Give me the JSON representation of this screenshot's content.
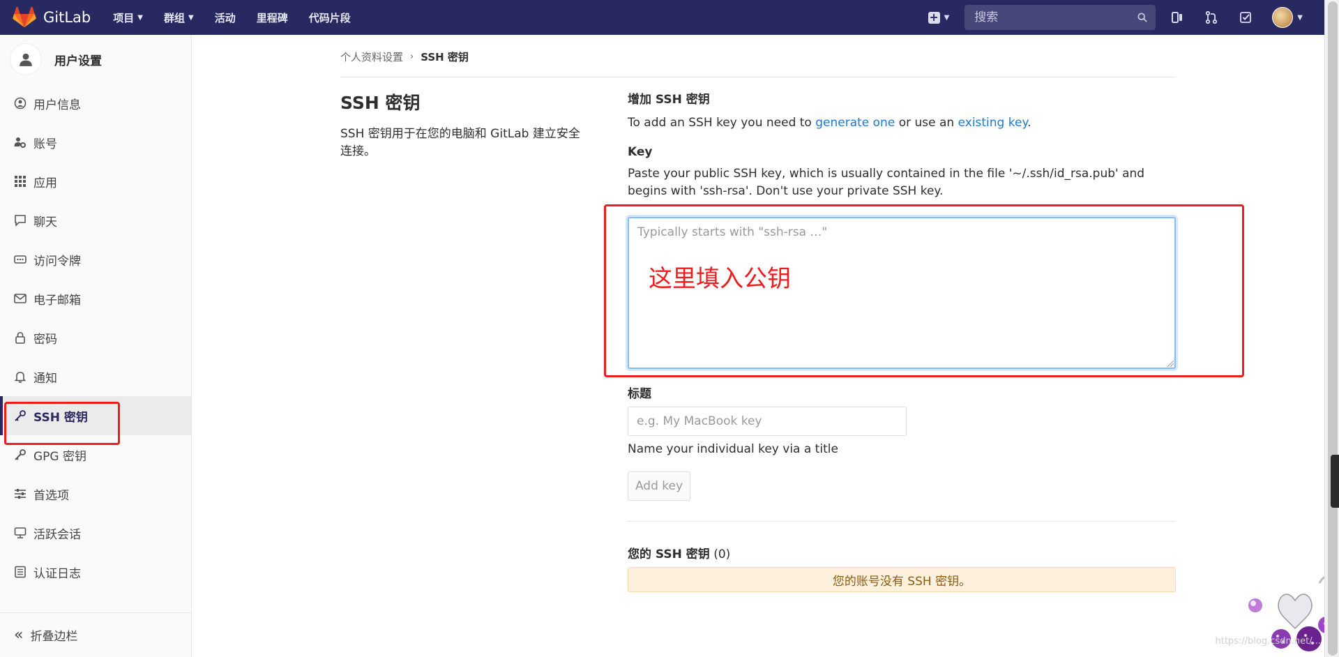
{
  "navbar": {
    "brand": "GitLab",
    "menu": [
      {
        "label": "项目",
        "has_dropdown": true
      },
      {
        "label": "群组",
        "has_dropdown": true
      },
      {
        "label": "活动",
        "has_dropdown": false
      },
      {
        "label": "里程碑",
        "has_dropdown": false
      },
      {
        "label": "代码片段",
        "has_dropdown": false
      }
    ],
    "search_placeholder": "搜索",
    "icons": [
      "plus-square-icon",
      "search-icon",
      "sidebar-panel-icon",
      "merge-request-icon",
      "todo-check-icon",
      "user-avatar"
    ],
    "colors": {
      "navbar_bg": "#292961",
      "search_bg": "#474779"
    }
  },
  "sidebar": {
    "title": "用户设置",
    "items": [
      {
        "label": "用户信息",
        "icon": "profile-icon",
        "active": false
      },
      {
        "label": "账号",
        "icon": "account-gear-icon",
        "active": false
      },
      {
        "label": "应用",
        "icon": "applications-grid-icon",
        "active": false
      },
      {
        "label": "聊天",
        "icon": "comment-icon",
        "active": false
      },
      {
        "label": "访问令牌",
        "icon": "token-icon",
        "active": false
      },
      {
        "label": "电子邮箱",
        "icon": "mail-icon",
        "active": false
      },
      {
        "label": "密码",
        "icon": "lock-icon",
        "active": false
      },
      {
        "label": "通知",
        "icon": "bell-icon",
        "active": false
      },
      {
        "label": "SSH 密钥",
        "icon": "key-icon",
        "active": true
      },
      {
        "label": "GPG 密钥",
        "icon": "key-icon",
        "active": false
      },
      {
        "label": "首选项",
        "icon": "preferences-icon",
        "active": false
      },
      {
        "label": "活跃会话",
        "icon": "monitor-icon",
        "active": false
      },
      {
        "label": "认证日志",
        "icon": "log-icon",
        "active": false
      }
    ],
    "collapse_label": "折叠边栏"
  },
  "breadcrumb": {
    "parent": "个人资料设置",
    "separator": "›",
    "current": "SSH 密钥"
  },
  "intro": {
    "heading": "SSH 密钥",
    "description": "SSH 密钥用于在您的电脑和 GitLab 建立安全连接。"
  },
  "form": {
    "section_title": "增加 SSH 密钥",
    "intro_prefix": "To add an SSH key you need to ",
    "generate_link": "generate one",
    "intro_middle": " or use an ",
    "existing_link": "existing key",
    "intro_suffix": ".",
    "key_label": "Key",
    "key_help": "Paste your public SSH key, which is usually contained in the file '~/.ssh/id_rsa.pub' and begins with 'ssh-rsa'. Don't use your private SSH key.",
    "key_placeholder": "Typically starts with \"ssh-rsa …\"",
    "key_value": "",
    "title_label": "标题",
    "title_placeholder": "e.g. My MacBook key",
    "title_value": "",
    "title_help": "Name your individual key via a title",
    "add_button": "Add key"
  },
  "keys": {
    "title": "您的 SSH 密钥",
    "count": "(0)",
    "empty_message": "您的账号没有 SSH 密钥。"
  },
  "annotation": {
    "text": "这里填入公钥",
    "color": "#ee1d1d"
  },
  "watermark": "https://blog.csdn.net/..."
}
